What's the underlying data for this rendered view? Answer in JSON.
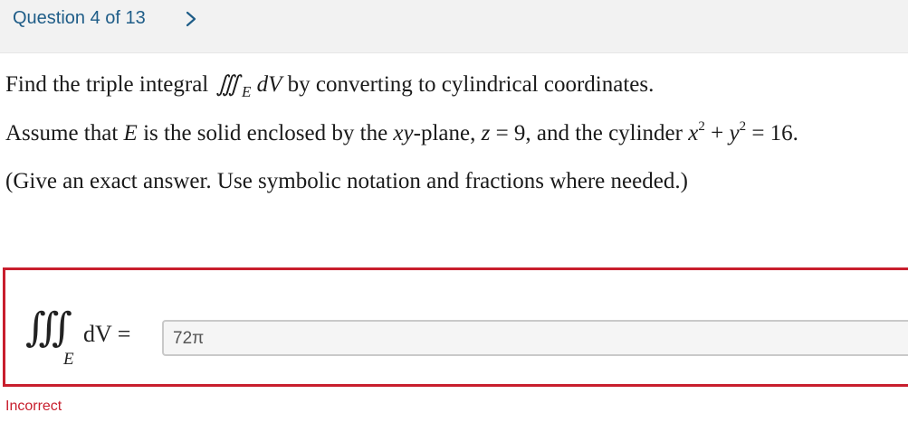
{
  "header": {
    "question_label": "Question 4 of 13",
    "next_icon": "chevron-right-icon"
  },
  "question": {
    "line1_prefix": "Find the triple integral",
    "integral_symbol": "∭",
    "region": "E",
    "differential": "dV",
    "line1_suffix": "by converting to cylindrical coordinates.",
    "line2_a": "Assume that",
    "line2_E": "E",
    "line2_b": "is the solid enclosed by the",
    "line2_xy": "xy",
    "line2_c": "-plane,",
    "line2_z": "z",
    "line2_d": "= 9, and the cylinder",
    "line2_x": "x",
    "line2_exp1": "2",
    "line2_plus": "+",
    "line2_y": "y",
    "line2_exp2": "2",
    "line2_e": "= 16.",
    "line3": "(Give an exact answer. Use symbolic notation and fractions where needed.)"
  },
  "answer": {
    "integral_symbol": "∭",
    "region": "E",
    "lhs": "dV =",
    "value": "72π",
    "status": "Incorrect"
  },
  "colors": {
    "header_text": "#1f5d88",
    "error": "#c81e2d",
    "header_bg": "#f2f2f2"
  }
}
